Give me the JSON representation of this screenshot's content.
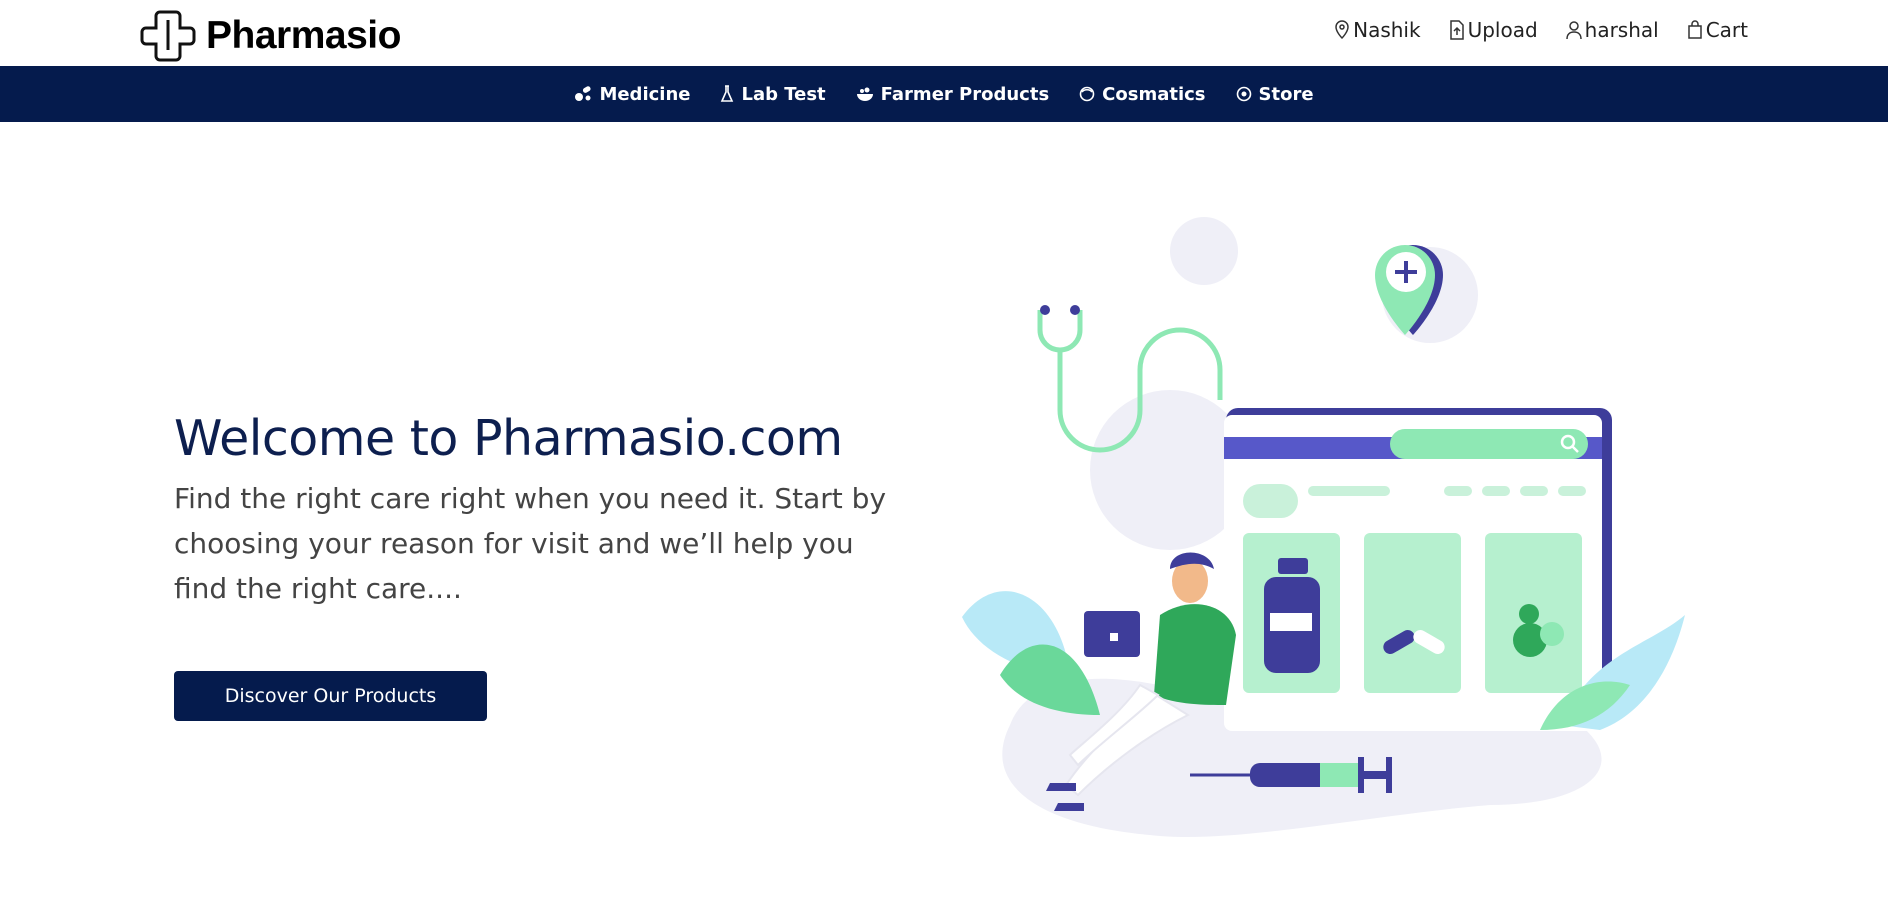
{
  "brand": {
    "name": "Pharmasio"
  },
  "top_links": [
    {
      "label": "Nashik",
      "icon": "map-pin-icon"
    },
    {
      "label": "Upload",
      "icon": "file-upload-icon"
    },
    {
      "label": "harshal",
      "icon": "user-icon"
    },
    {
      "label": "Cart",
      "icon": "shopping-bag-icon"
    }
  ],
  "nav": [
    {
      "label": "Medicine",
      "icon": "pills-icon"
    },
    {
      "label": "Lab Test",
      "icon": "flask-icon"
    },
    {
      "label": "Farmer Products",
      "icon": "bowl-icon"
    },
    {
      "label": "Cosmatics",
      "icon": "face-icon"
    },
    {
      "label": "Store",
      "icon": "store-icon"
    }
  ],
  "hero": {
    "title": "Welcome to Pharmasio.com",
    "subtitle": "Find the right care right when you need it. Start by choosing your reason for visit and we’ll help you find the right care....",
    "cta_label": "Discover Our Products"
  },
  "colors": {
    "navy": "#051b4d",
    "green": "#2fa85a",
    "mint": "#8ee8b4",
    "purple": "#3e3d9a"
  }
}
